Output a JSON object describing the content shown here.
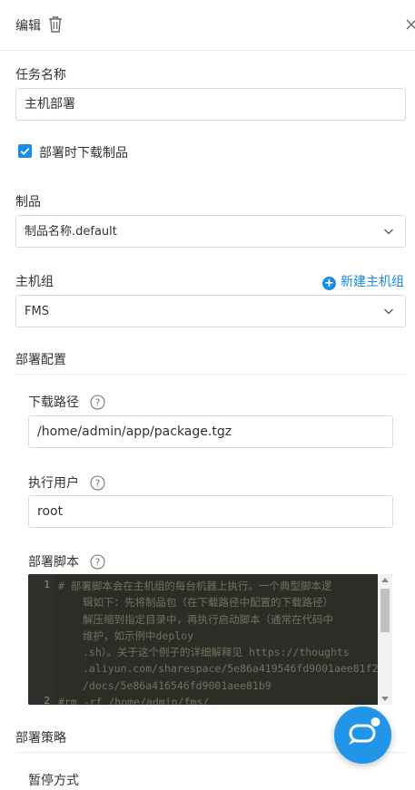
{
  "header": {
    "title": "编辑",
    "trash_icon": "trash-icon",
    "close_icon": "close-icon"
  },
  "task_name": {
    "label": "任务名称",
    "value": "主机部署"
  },
  "download_product": {
    "label": "部署时下载制品",
    "checked": true
  },
  "product": {
    "label": "制品",
    "value": "制品名称.default"
  },
  "host_group": {
    "label": "主机组",
    "value": "FMS",
    "add_label": "新建主机组"
  },
  "deploy_config": {
    "title": "部署配置",
    "download_path": {
      "label": "下载路径",
      "value": "/home/admin/app/package.tgz"
    },
    "exec_user": {
      "label": "执行用户",
      "value": "root"
    },
    "script": {
      "label": "部署脚本",
      "line_numbers": [
        "1",
        "2"
      ],
      "line1": [
        "# 部署脚本会在主机组的每台机器上执行。一个典型脚本逻",
        "辑如下：先将制品包（在下载路径中配置的下载路径）",
        "解压缩到指定目录中，再执行启动脚本（通常在代码中",
        "维护，如示例中deploy",
        ".sh）。关于这个例子的详细解释见 https://thoughts",
        ".aliyun.com/sharespace/5e86a419546fd9001aee81f2",
        "/docs/5e86a416546fd9001aee81b9"
      ],
      "line2": "#rm -rf /home/admin/fms/"
    }
  },
  "deploy_strategy": {
    "title": "部署策略",
    "pause_label": "暂停方式"
  },
  "colors": {
    "accent": "#1b8ce3",
    "editor_bg": "#2b2d27",
    "comment": "#75715e"
  },
  "fab_icon": "chat-bubble-icon"
}
